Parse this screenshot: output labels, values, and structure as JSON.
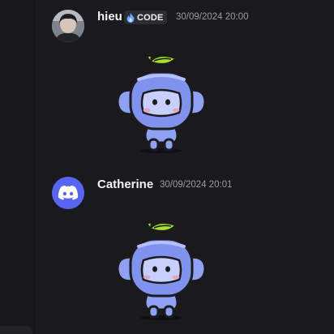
{
  "messages": [
    {
      "username": "hieu",
      "tag": {
        "label": "CODE",
        "icon": "flame-icon"
      },
      "timestamp": "30/09/2024 20:00",
      "avatar": "profile-photo",
      "attachment": "wumpus-sticker"
    },
    {
      "username": "Catherine",
      "timestamp": "30/09/2024 20:01",
      "avatar": "discord-logo-icon",
      "attachment": "wumpus-sticker"
    }
  ],
  "colors": {
    "background": "#1a1a1e",
    "brand": "#5865f2",
    "wumpus": "#7f93ee",
    "leaf": "#a6e22e"
  }
}
